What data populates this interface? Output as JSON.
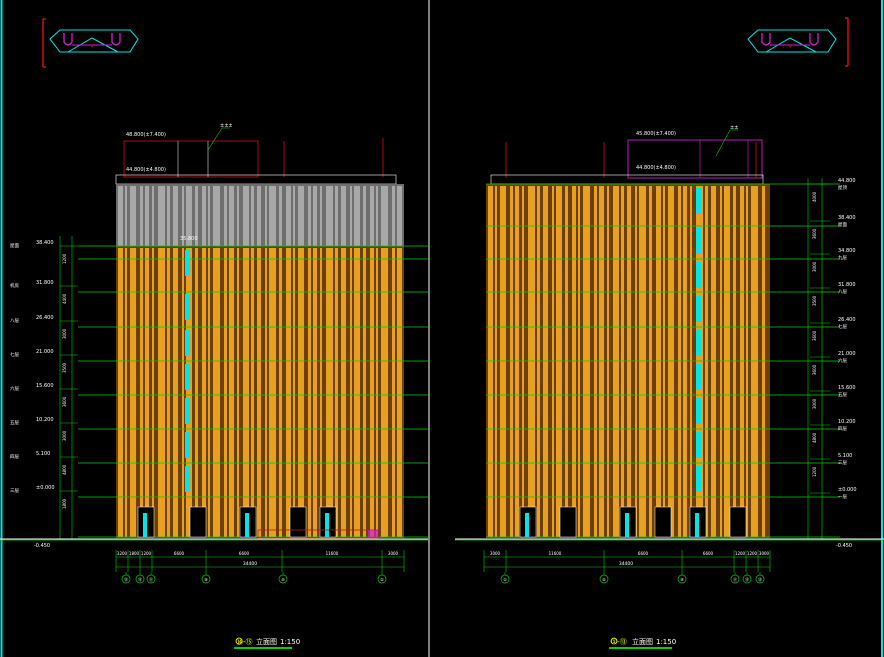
{
  "colors": {
    "background": "#000000",
    "facade_orange": "#e8a020",
    "facade_dark": "#7a4a08",
    "roof_grey": "#8c8c8c",
    "cyan": "#00e5e5",
    "level_green": "#00d000",
    "red": "#d01010",
    "magenta": "#d020d0",
    "white": "#ffffff"
  },
  "panels": {
    "left": {
      "caption_tag": "⑭-⑮",
      "caption": "立面图",
      "scale": "1:150",
      "roof_label_top": "48.800(±7.400)",
      "roof_label_low": "44.800(±4.800)",
      "roof_tag": "±±±",
      "cyan_tag": "35.800",
      "level_labels": [
        "38.400",
        "31.800",
        "26.400",
        "21.000",
        "15.600",
        "10.200",
        "5.100",
        "±0.000"
      ],
      "side_labels": [
        "屋面",
        "机房",
        "八层",
        "七层",
        "六层",
        "五层",
        "四层",
        "三层"
      ],
      "dims_vertical": [
        "1200",
        "4400",
        "3000",
        "3500",
        "3600",
        "3000",
        "4800",
        "1800"
      ],
      "ground_label": "-0.450",
      "dims_bottom": [
        "3200",
        "1800",
        "1200",
        "6600",
        "6600",
        "11600",
        "3000"
      ],
      "total_dim": "34400",
      "axis_labels": [
        "⑬",
        "⑫",
        "⑪",
        "⑨",
        "⑤",
        "①"
      ]
    },
    "right": {
      "caption_tag": "①-⑬",
      "caption": "立面图",
      "scale": "1:150",
      "roof_label_top": "45.800(±7.400)",
      "roof_label_low": "44.800(±4.800)",
      "roof_tag": "±±",
      "level_labels": [
        "44.800",
        "38.400",
        "34.800",
        "31.800",
        "26.400",
        "21.000",
        "15.600",
        "10.200",
        "5.100",
        "±0.000"
      ],
      "side_labels": [
        "屋顶",
        "屋面",
        "九层",
        "八层",
        "七层",
        "六层",
        "五层",
        "四层",
        "三层",
        "一层"
      ],
      "dims_vertical": [
        "4000",
        "3600",
        "3000",
        "3500",
        "3600",
        "3600",
        "3000",
        "4800",
        "1200"
      ],
      "ground_label": "-0.450",
      "dims_bottom": [
        "3000",
        "11600",
        "6600",
        "6600",
        "1200",
        "1200",
        "3000"
      ],
      "total_dim": "34400",
      "axis_labels": [
        "①",
        "⑤",
        "⑨",
        "⑪",
        "⑫",
        "⑬"
      ]
    }
  }
}
